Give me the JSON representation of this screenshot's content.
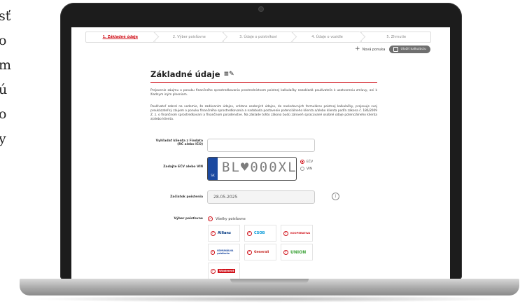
{
  "side_text": [
    "sť",
    "o",
    "m",
    "ú",
    "o",
    "y"
  ],
  "steps": [
    {
      "label": "1. Základné údaje",
      "active": true
    },
    {
      "label": "2. Výber poisťovne",
      "active": false
    },
    {
      "label": "3. Údaje o poistníkovi",
      "active": false
    },
    {
      "label": "4. Údaje o vozidle",
      "active": false
    },
    {
      "label": "5. Zhrnutie",
      "active": false
    }
  ],
  "actions": {
    "new_offer": "Nová ponuka",
    "save_calc": "Uložiť kalkuláciu"
  },
  "heading": "Základné údaje",
  "paragraphs": [
    "Prejavenie záujmu o ponuku finančného sprostredkovania prostredníctvom poistnej kalkulačky nezakladá používateľa k uzatvoreniu zmluvy, ani k žiadnym iným plneniam.",
    "Používateľ zobral na vedomie, že zadávaním údajov, vrátane osobných údajov, do nasledovných formulárov poistnej kalkulačky, prejavuje svoj preukázateľný záujem o ponuku finančného sprostredkovania a nadobúda postavenie potenciálneho klienta a/alebo klienta podľa zákona č. 186/2009 Z. z. o finančnom sprostredkovaní a finančnom poradenstve. Na základe tohto zákona budú zároveň spracúvané osobné údaje potenciálneho klienta a/alebo klienta."
  ],
  "form": {
    "search_client_label_1": "Vyhľadať klienta z Findata",
    "search_client_label_2": "(RČ alebo IČO)",
    "ecv_label": "Zadajte EČV alebo VIN",
    "plate_value": "BL♥000XL",
    "plate_country": "SK",
    "radio_ecv": "EČV",
    "radio_vin": "VIN",
    "start_label": "Začiatok poistenia",
    "start_value": "28.05.2025",
    "insurer_label": "Výber poisťovne",
    "all_insurers": "Všetky poisťovne"
  },
  "insurers": [
    "Allianz",
    "CSOB",
    "KOOPERATIVA",
    "KOMUNÁLNA poisťovňa",
    "Generali",
    "UNION",
    "Wüstenrot"
  ],
  "colors": {
    "accent": "#d0111a",
    "plate_blue": "#1b49a0",
    "text": "#333333"
  }
}
